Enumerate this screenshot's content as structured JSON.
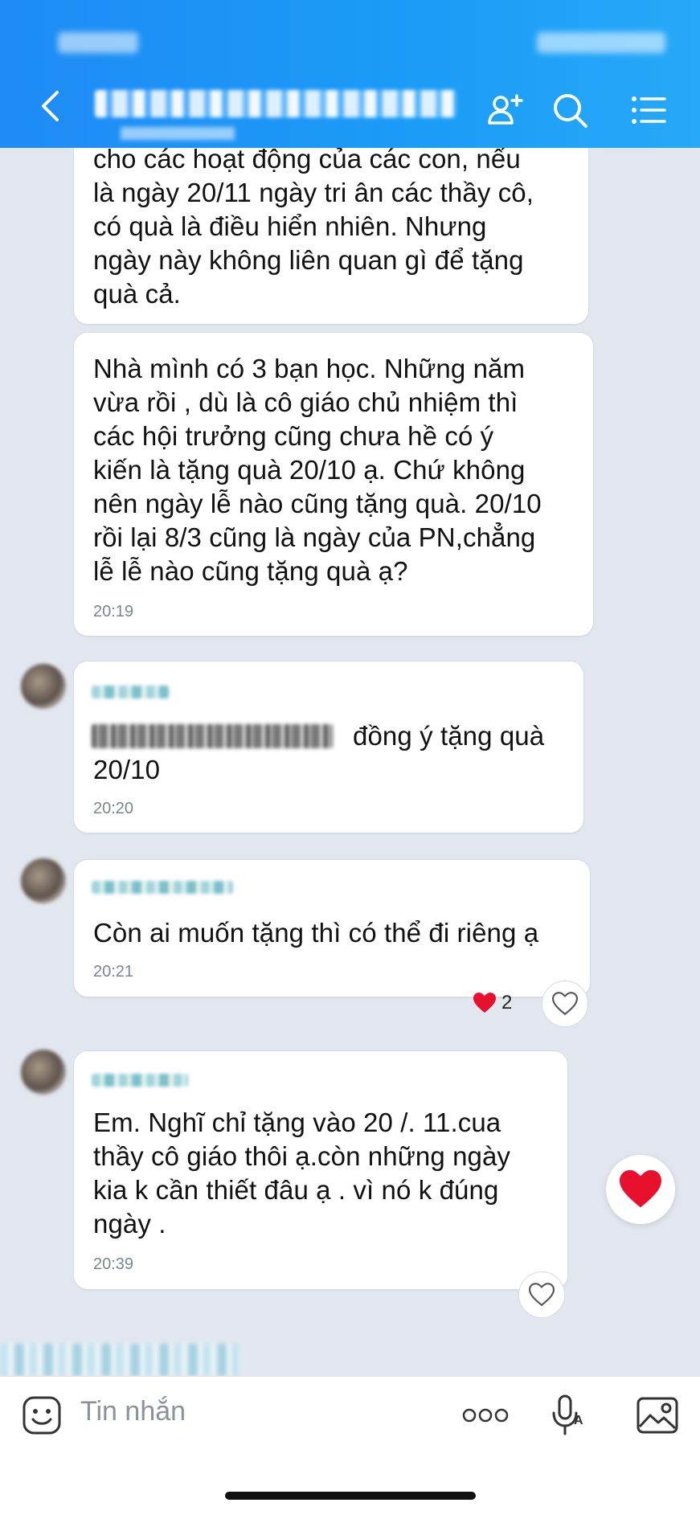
{
  "header": {
    "back_icon": "chevron-left-icon",
    "add_member_icon": "add-user-icon",
    "search_icon": "search-icon",
    "menu_icon": "list-menu-icon"
  },
  "messages": [
    {
      "text": "cho các hoạt động của các con, nếu\nlà ngày 20/11 ngày tri ân các thầy cô,\ncó quà là điều hiển nhiên. Nhưng\nngày này không liên quan gì để tặng\nquà cả."
    },
    {
      "text": "Nhà mình có 3 bạn học. Những năm\nvừa rồi , dù là cô giáo chủ nhiệm thì\ncác hội trưởng cũng chưa hề có ý\nkiến là tặng quà 20/10 ạ. Chứ không\nnên ngày lễ nào cũng tặng quà. 20/10\nrồi lại 8/3 cũng là ngày của PN,chẳng\nlễ lễ nào cũng tặng quà ạ?",
      "time": "20:19"
    },
    {
      "text_visible": "đồng ý tặng quà\n20/10",
      "time": "20:20"
    },
    {
      "text": "Còn ai muốn tặng thì có thể đi riêng ạ",
      "time": "20:21",
      "reaction_count": "2"
    },
    {
      "text": "Em. Nghĩ chỉ tặng vào 20 /. 11.cua\nthầy cô giáo thôi ạ.còn những ngày\nkia k cần thiết đâu ạ . vì  nó k đúng\nngày .",
      "time": "20:39"
    }
  ],
  "composer": {
    "placeholder": "Tin nhắn"
  },
  "colors": {
    "header": "#1a9cf7",
    "chat_bg": "#e2e7ef",
    "heart": "#e8112d"
  }
}
